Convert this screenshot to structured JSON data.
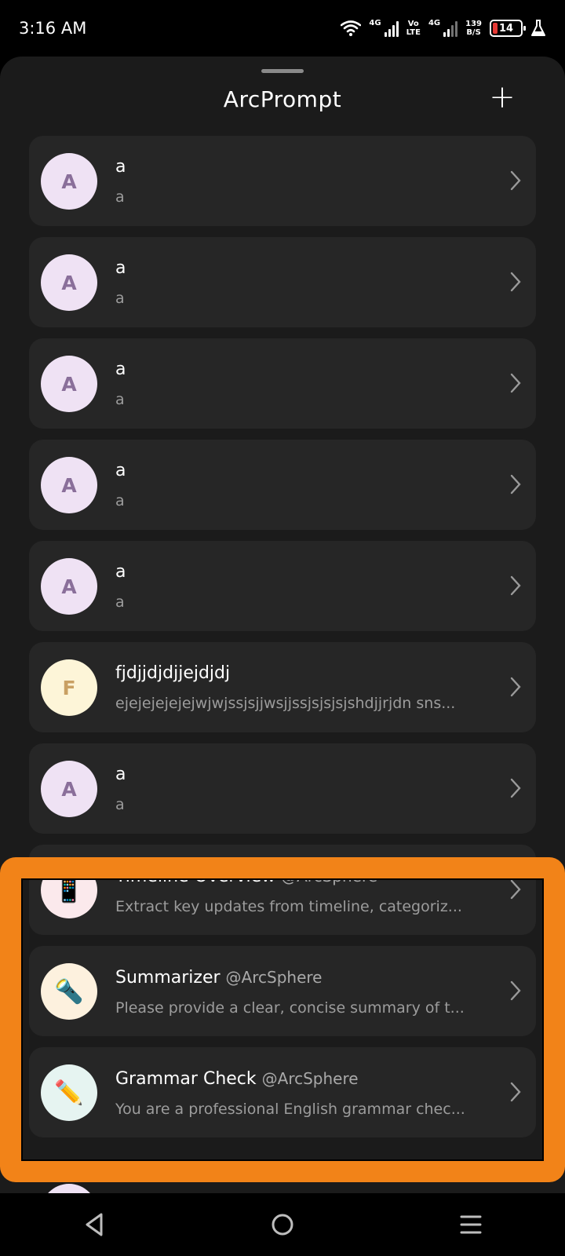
{
  "status_bar": {
    "time": "3:16 AM",
    "sim1_label": "4G",
    "volte_top": "Vo",
    "volte_bottom": "LTE",
    "sim2_label": "4G",
    "speed_value": "139",
    "speed_unit": "B/S",
    "battery_level": "14"
  },
  "sheet": {
    "title": "ArcPrompt",
    "add_label": "+"
  },
  "prompts": [
    {
      "initial": "A",
      "title": "a",
      "author": "",
      "subtitle": "a"
    },
    {
      "initial": "A",
      "title": "a",
      "author": "",
      "subtitle": "a"
    },
    {
      "initial": "A",
      "title": "a",
      "author": "",
      "subtitle": "a"
    },
    {
      "initial": "A",
      "title": "a",
      "author": "",
      "subtitle": "a"
    },
    {
      "initial": "A",
      "title": "a",
      "author": "",
      "subtitle": "a"
    },
    {
      "initial": "F",
      "title": "fjdjjdjdjjejdjdj",
      "author": "",
      "subtitle": "ejejejejejejwjwjssjsjjwsjjssjsjsjsjshdjjrjdn sns..."
    },
    {
      "initial": "A",
      "title": "a",
      "author": "",
      "subtitle": "a"
    },
    {
      "initial": "📱",
      "title": "Timeline Overview",
      "author": "@ArcSphere",
      "subtitle": "Extract key updates from timeline, categoriz..."
    },
    {
      "initial": "🔦",
      "title": "Summarizer",
      "author": "@ArcSphere",
      "subtitle": "Please provide a clear, concise summary of t..."
    },
    {
      "initial": "✏️",
      "title": "Grammar Check",
      "author": "@ArcSphere",
      "subtitle": "You are a professional English grammar chec..."
    }
  ],
  "colors": {
    "highlight": "#f28318",
    "card": "#262626",
    "sheet": "#1b1b1b"
  },
  "icons": {
    "chevron": "chevron-right-icon",
    "back": "back-triangle-icon",
    "home": "home-circle-icon",
    "recents": "menu-lines-icon"
  }
}
